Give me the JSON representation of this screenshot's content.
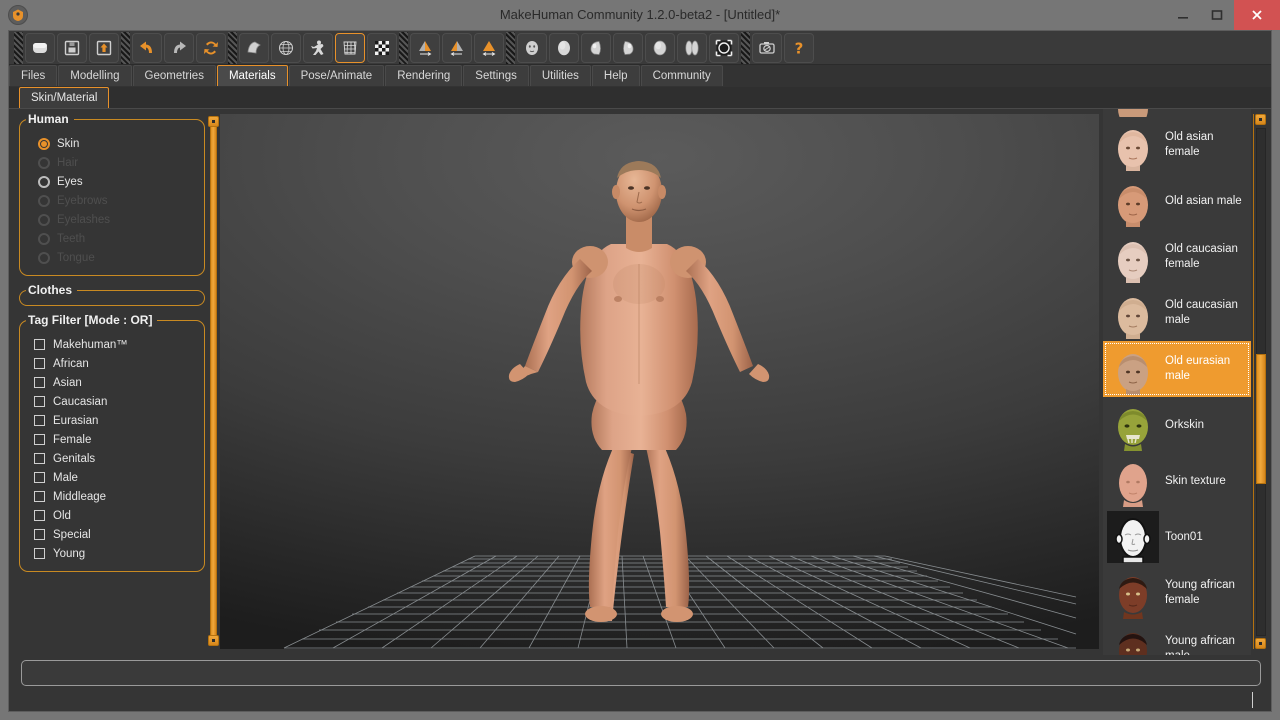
{
  "window": {
    "title": "MakeHuman Community 1.2.0-beta2 - [Untitled]*",
    "logo_icon": "makehuman-logo-icon",
    "minimize_icon": "minimize-icon",
    "maximize_icon": "maximize-icon",
    "close_icon": "close-icon"
  },
  "toolbar": {
    "groups": [
      {
        "buttons": [
          {
            "icon": "new-file-icon",
            "tooltip": "New",
            "active": false
          },
          {
            "icon": "save-icon",
            "tooltip": "Save",
            "active": false
          },
          {
            "icon": "load-icon",
            "tooltip": "Load",
            "active": false
          }
        ]
      },
      {
        "buttons": [
          {
            "icon": "undo-icon",
            "tooltip": "Undo",
            "active": false
          },
          {
            "icon": "redo-icon",
            "tooltip": "Redo",
            "active": false
          },
          {
            "icon": "reset-mesh-icon",
            "tooltip": "Reset mesh",
            "active": false
          }
        ]
      },
      {
        "buttons": [
          {
            "icon": "smooth-icon",
            "tooltip": "Smooth",
            "active": false
          },
          {
            "icon": "wireframe-icon",
            "tooltip": "Wireframe",
            "active": false
          },
          {
            "icon": "pose-icon",
            "tooltip": "Pose",
            "active": false
          },
          {
            "icon": "grid-icon",
            "tooltip": "Grid",
            "active": true
          },
          {
            "icon": "background-icon",
            "tooltip": "Background",
            "active": false
          }
        ]
      },
      {
        "buttons": [
          {
            "icon": "symmetry-right-icon",
            "tooltip": "Symmetry right",
            "active": false
          },
          {
            "icon": "symmetry-left-icon",
            "tooltip": "Symmetry left",
            "active": false
          },
          {
            "icon": "symmetry-both-icon",
            "tooltip": "Symmetry",
            "active": false
          }
        ]
      },
      {
        "buttons": [
          {
            "icon": "front-view-icon",
            "tooltip": "Front view",
            "active": false
          },
          {
            "icon": "back-view-icon",
            "tooltip": "Back view",
            "active": false
          },
          {
            "icon": "left-view-icon",
            "tooltip": "Left view",
            "active": false
          },
          {
            "icon": "right-view-icon",
            "tooltip": "Right view",
            "active": false
          },
          {
            "icon": "top-view-icon",
            "tooltip": "Top view",
            "active": false
          },
          {
            "icon": "bottom-view-icon",
            "tooltip": "Bottom view",
            "active": false
          },
          {
            "icon": "reset-camera-icon",
            "tooltip": "Reset camera",
            "active": false
          }
        ]
      },
      {
        "buttons": [
          {
            "icon": "grab-screen-icon",
            "tooltip": "Grab screen",
            "active": false
          },
          {
            "icon": "help-icon",
            "tooltip": "Help",
            "active": false
          }
        ]
      }
    ]
  },
  "tabs": {
    "items": [
      {
        "label": "Files",
        "active": false
      },
      {
        "label": "Modelling",
        "active": false
      },
      {
        "label": "Geometries",
        "active": false
      },
      {
        "label": "Materials",
        "active": true
      },
      {
        "label": "Pose/Animate",
        "active": false
      },
      {
        "label": "Rendering",
        "active": false
      },
      {
        "label": "Settings",
        "active": false
      },
      {
        "label": "Utilities",
        "active": false
      },
      {
        "label": "Help",
        "active": false
      },
      {
        "label": "Community",
        "active": false
      }
    ]
  },
  "subtabs": {
    "items": [
      {
        "label": "Skin/Material",
        "active": true
      }
    ]
  },
  "left_panel": {
    "human_group": {
      "title": "Human",
      "options": [
        {
          "label": "Skin",
          "selected": true,
          "disabled": false
        },
        {
          "label": "Hair",
          "selected": false,
          "disabled": true
        },
        {
          "label": "Eyes",
          "selected": false,
          "disabled": false
        },
        {
          "label": "Eyebrows",
          "selected": false,
          "disabled": true
        },
        {
          "label": "Eyelashes",
          "selected": false,
          "disabled": true
        },
        {
          "label": "Teeth",
          "selected": false,
          "disabled": true
        },
        {
          "label": "Tongue",
          "selected": false,
          "disabled": true
        }
      ]
    },
    "clothes_group": {
      "title": "Clothes",
      "options": []
    },
    "tag_filter_group": {
      "title": "Tag Filter [Mode : OR]",
      "options": [
        {
          "label": "Makehuman™",
          "checked": false
        },
        {
          "label": "African",
          "checked": false
        },
        {
          "label": "Asian",
          "checked": false
        },
        {
          "label": "Caucasian",
          "checked": false
        },
        {
          "label": "Eurasian",
          "checked": false
        },
        {
          "label": "Female",
          "checked": false
        },
        {
          "label": "Genitals",
          "checked": false
        },
        {
          "label": "Male",
          "checked": false
        },
        {
          "label": "Middleage",
          "checked": false
        },
        {
          "label": "Old",
          "checked": false
        },
        {
          "label": "Special",
          "checked": false
        },
        {
          "label": "Young",
          "checked": false
        }
      ]
    }
  },
  "material_list": {
    "items": [
      {
        "label": "",
        "selected": false,
        "skin": "#c99a7a",
        "partial": true
      },
      {
        "label": "Old asian female",
        "selected": false,
        "skin": "#e8c2ad"
      },
      {
        "label": "Old asian male",
        "selected": false,
        "skin": "#d79a78"
      },
      {
        "label": "Old caucasian female",
        "selected": false,
        "skin": "#e6cdc0"
      },
      {
        "label": "Old caucasian male",
        "selected": false,
        "skin": "#dcbb9e"
      },
      {
        "label": "Old eurasian male",
        "selected": true,
        "skin": "#caa183"
      },
      {
        "label": "Orkskin",
        "selected": false,
        "skin": "#97a33a"
      },
      {
        "label": "Skin texture",
        "selected": false,
        "skin": "#e0a38c"
      },
      {
        "label": "Toon01",
        "selected": false,
        "skin": "#f2f2f2"
      },
      {
        "label": "Young african female",
        "selected": false,
        "skin": "#7d3d28"
      },
      {
        "label": "Young african male",
        "selected": false,
        "skin": "#5e2f1f"
      }
    ]
  },
  "viewport": {
    "model_name": "human-figure-3d",
    "ground_grid": "ground-grid",
    "skin_tone": "#d9a183"
  },
  "statusbar": {
    "text": "",
    "progress": 0
  },
  "colors": {
    "accent": "#e8912a",
    "panel_bg": "#353535",
    "toolbar_bg": "#3a3a3a",
    "titlebar_bg": "#767676",
    "close_red": "#d25252",
    "selected_item": "#ef9b2f"
  }
}
